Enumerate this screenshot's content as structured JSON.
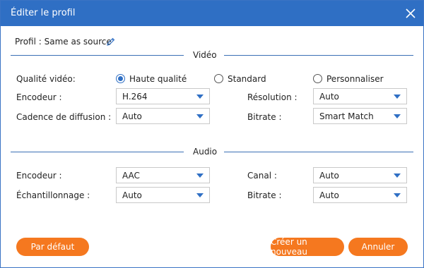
{
  "window": {
    "title": "Éditer le profil",
    "close_icon": "close-icon"
  },
  "profile": {
    "text": "Profil : Same as source",
    "edit_icon": "pencil-icon"
  },
  "video": {
    "section_title": "Vidéo",
    "quality_label": "Qualité vidéo:",
    "quality_options": [
      "Haute qualité",
      "Standard",
      "Personnaliser"
    ],
    "quality_selected": "Haute qualité",
    "encoder_label": "Encodeur :",
    "encoder_value": "H.264",
    "framerate_label": "Cadence de diffusion :",
    "framerate_value": "Auto",
    "resolution_label": "Résolution :",
    "resolution_value": "Auto",
    "bitrate_label": "Bitrate :",
    "bitrate_value": "Smart Match"
  },
  "audio": {
    "section_title": "Audio",
    "encoder_label": "Encodeur :",
    "encoder_value": "AAC",
    "samplerate_label": "Échantillonnage :",
    "samplerate_value": "Auto",
    "channel_label": "Canal :",
    "channel_value": "Auto",
    "bitrate_label": "Bitrate :",
    "bitrate_value": "Auto"
  },
  "buttons": {
    "default": "Par défaut",
    "create": "Créer un nouveau",
    "cancel": "Annuler"
  },
  "colors": {
    "accent": "#2f6fc4",
    "button": "#f5781f",
    "line": "#3a6fb5"
  }
}
